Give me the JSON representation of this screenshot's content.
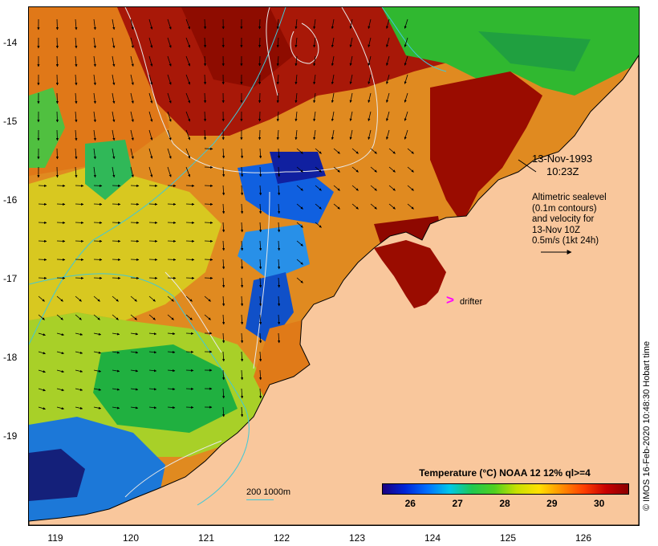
{
  "map": {
    "date": "13-Nov-1993",
    "time": "10:23Z",
    "altimetry_lines": [
      "Altimetric sealevel",
      "(0.1m contours)",
      "and velocity for",
      "13-Nov 10Z",
      "0.5m/s (1kt 24h)"
    ],
    "drifter_symbol": ">",
    "drifter_label": "drifter",
    "depth_legend": "200  1000m",
    "credit": "© IMOS 16-Feb-2020 10:48:30 Hobart time",
    "colors": {
      "land": "#f9c79c",
      "depth_contour": "#40c8d8",
      "sealevel_contour": "#e8e8e8",
      "drifter": "#ff00ff"
    }
  },
  "axes": {
    "x_ticks": [
      "119",
      "120",
      "121",
      "122",
      "123",
      "124",
      "125",
      "126"
    ],
    "y_ticks": [
      "-14",
      "-15",
      "-16",
      "-17",
      "-18",
      "-19"
    ]
  },
  "legend": {
    "title": "Temperature (°C) NOAA 12 12% ql>=4",
    "labels": [
      "26",
      "27",
      "28",
      "29",
      "30"
    ],
    "range": [
      25.4,
      30.6
    ]
  }
}
